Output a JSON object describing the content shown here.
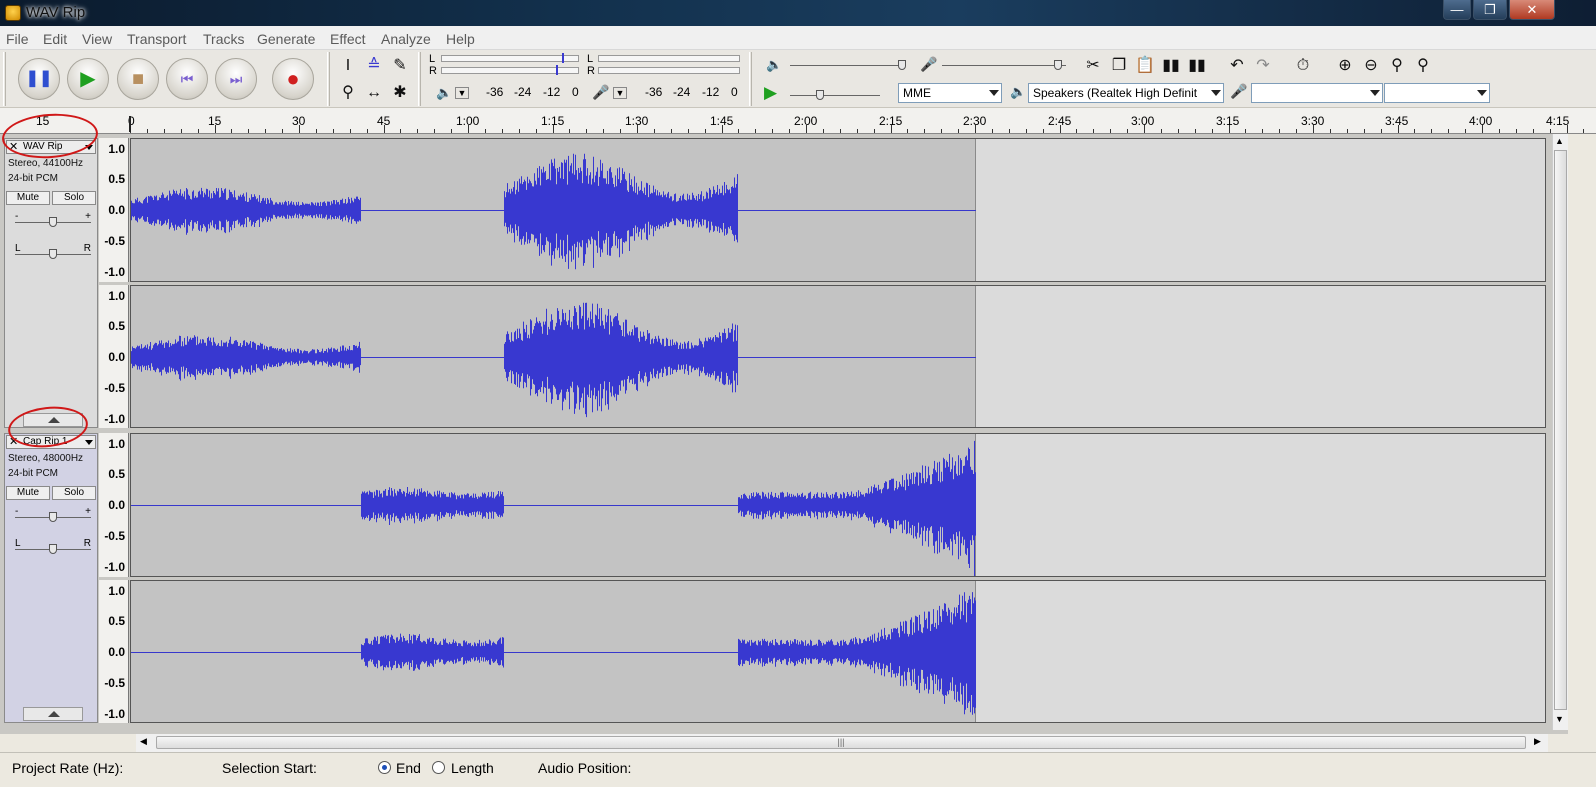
{
  "window": {
    "title": "WAV Rip",
    "buttons": [
      "minimize",
      "maximize",
      "close"
    ]
  },
  "menu": [
    "File",
    "Edit",
    "View",
    "Transport",
    "Tracks",
    "Generate",
    "Effect",
    "Analyze",
    "Help"
  ],
  "transport": {
    "pause": "pause-icon",
    "play": "play-icon",
    "stop": "stop-icon",
    "skip_start": "skip-start-icon",
    "skip_end": "skip-end-icon",
    "record": "record-icon"
  },
  "meters": {
    "playback": {
      "L": "L",
      "R": "R",
      "scale": [
        "-36",
        "-24",
        "-12",
        "0"
      ]
    },
    "record": {
      "L": "L",
      "R": "R",
      "scale": [
        "-36",
        "-24",
        "-12",
        "0"
      ]
    }
  },
  "devices": {
    "host": "MME",
    "output": "Speakers (Realtek High Definit",
    "input": "",
    "channels": ""
  },
  "ruler": {
    "labels": [
      "15",
      "0",
      "15",
      "30",
      "45",
      "1:00",
      "1:15",
      "1:30",
      "1:45",
      "2:00",
      "2:15",
      "2:30",
      "2:45",
      "3:00",
      "3:15",
      "3:30",
      "3:45",
      "4:00",
      "4:15"
    ]
  },
  "vruler": [
    "1.0",
    "0.5",
    "0.0",
    "-0.5",
    "-1.0"
  ],
  "tracks": [
    {
      "name": "WAV Rip",
      "rate": "Stereo, 44100Hz",
      "format": "24-bit PCM",
      "mute": "Mute",
      "solo": "Solo",
      "gain_minus": "-",
      "gain_plus": "+",
      "pan_left": "L",
      "pan_right": "R"
    },
    {
      "name": "Cap Rip 1",
      "rate": "Stereo, 48000Hz",
      "format": "24-bit PCM",
      "mute": "Mute",
      "solo": "Solo",
      "gain_minus": "-",
      "gain_plus": "+",
      "pan_left": "L",
      "pan_right": "R"
    }
  ],
  "hscroll_grip": "|||",
  "status": {
    "project_rate_label": "Project Rate (Hz):",
    "selection_start_label": "Selection Start:",
    "end_label": "End",
    "length_label": "Length",
    "audio_position_label": "Audio Position:"
  },
  "colors": {
    "waveform": "#3838D0",
    "selection_highlight": "#D01818"
  }
}
